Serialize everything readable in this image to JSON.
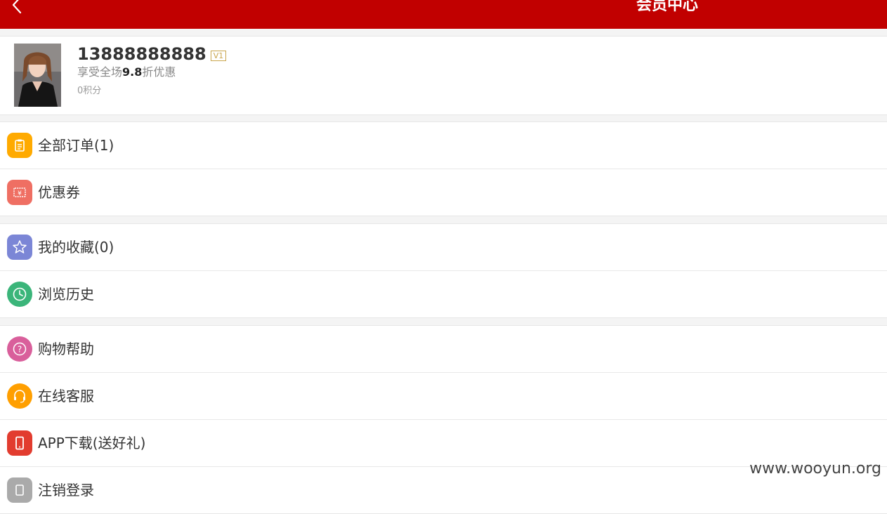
{
  "header": {
    "back_icon": "chevron-left-icon",
    "title": "会员中心",
    "background": "#c10000"
  },
  "profile": {
    "avatar": "avatar-photo",
    "phone": "13888888888",
    "level_badge": "V1",
    "discount_prefix": "享受全场",
    "discount_value": "9.8",
    "discount_suffix": "折优惠",
    "points": "0积分"
  },
  "menu_groups": [
    {
      "items": [
        {
          "label": "全部订单(1)",
          "icon": "clipboard-icon",
          "color": "#ffaa00"
        },
        {
          "label": "优惠券",
          "icon": "coupon-icon",
          "color": "#ef6f63"
        }
      ]
    },
    {
      "items": [
        {
          "label": "我的收藏(0)",
          "icon": "star-icon",
          "color": "#7b86d6"
        },
        {
          "label": "浏览历史",
          "icon": "clock-icon",
          "color": "#3bb57a"
        }
      ]
    },
    {
      "items": [
        {
          "label": "购物帮助",
          "icon": "help-icon",
          "color": "#d95f9b"
        },
        {
          "label": "在线客服",
          "icon": "headset-icon",
          "color": "#ff9f00"
        },
        {
          "label": "APP下载(送好礼)",
          "icon": "phone-icon",
          "color": "#e23c2f"
        },
        {
          "label": "注销登录",
          "icon": "logout-icon",
          "color": "#aaaaaa"
        }
      ]
    }
  ],
  "watermark": "www.wooyun.org"
}
